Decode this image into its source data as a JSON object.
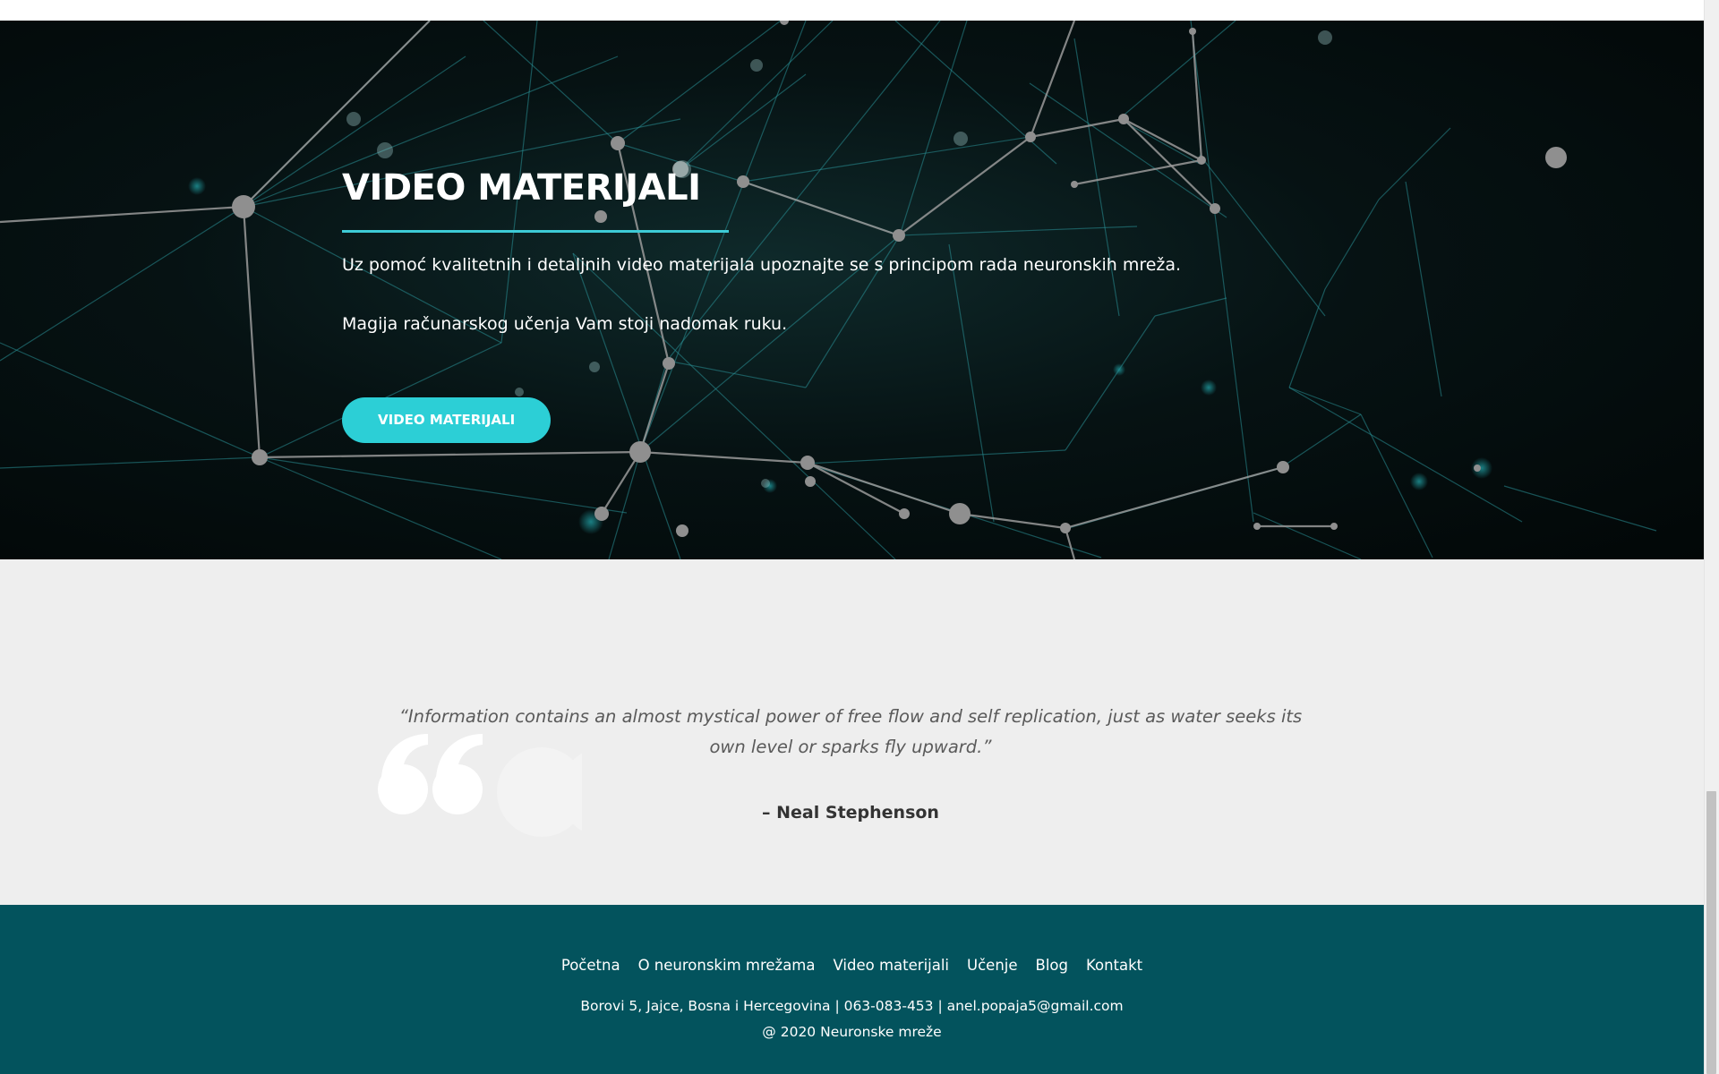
{
  "hero": {
    "title": "VIDEO MATERIJALI",
    "text_1": "Uz pomoć kvalitetnih i detaljnih video materijala upoznajte se s principom rada neuronskih mreža.",
    "text_2": "Magija računarskog učenja Vam stoji nadomak ruku.",
    "button_label": "VIDEO MATERIJALI",
    "background_image": "neural-network-illustration",
    "accent_color": "#2ccfd6"
  },
  "quote": {
    "icon": "quote-mark-icon",
    "text": "“Information contains an almost mystical power of free flow and self replication, just as water seeks its own level or sparks fly upward.”",
    "author": "– Neal Stephenson",
    "background_color": "#eeeeee"
  },
  "footer": {
    "nav": [
      {
        "label": "Početna"
      },
      {
        "label": "O neuronskim mrežama"
      },
      {
        "label": "Video materijali"
      },
      {
        "label": "Učenje"
      },
      {
        "label": "Blog"
      },
      {
        "label": "Kontakt"
      }
    ],
    "contact": "Borovi 5, Jajce, Bosna i Hercegovina | 063-083-453 | anel.popaja5@gmail.com",
    "copyright": "@ 2020 Neuronske mreže",
    "background_color": "#03535d"
  }
}
